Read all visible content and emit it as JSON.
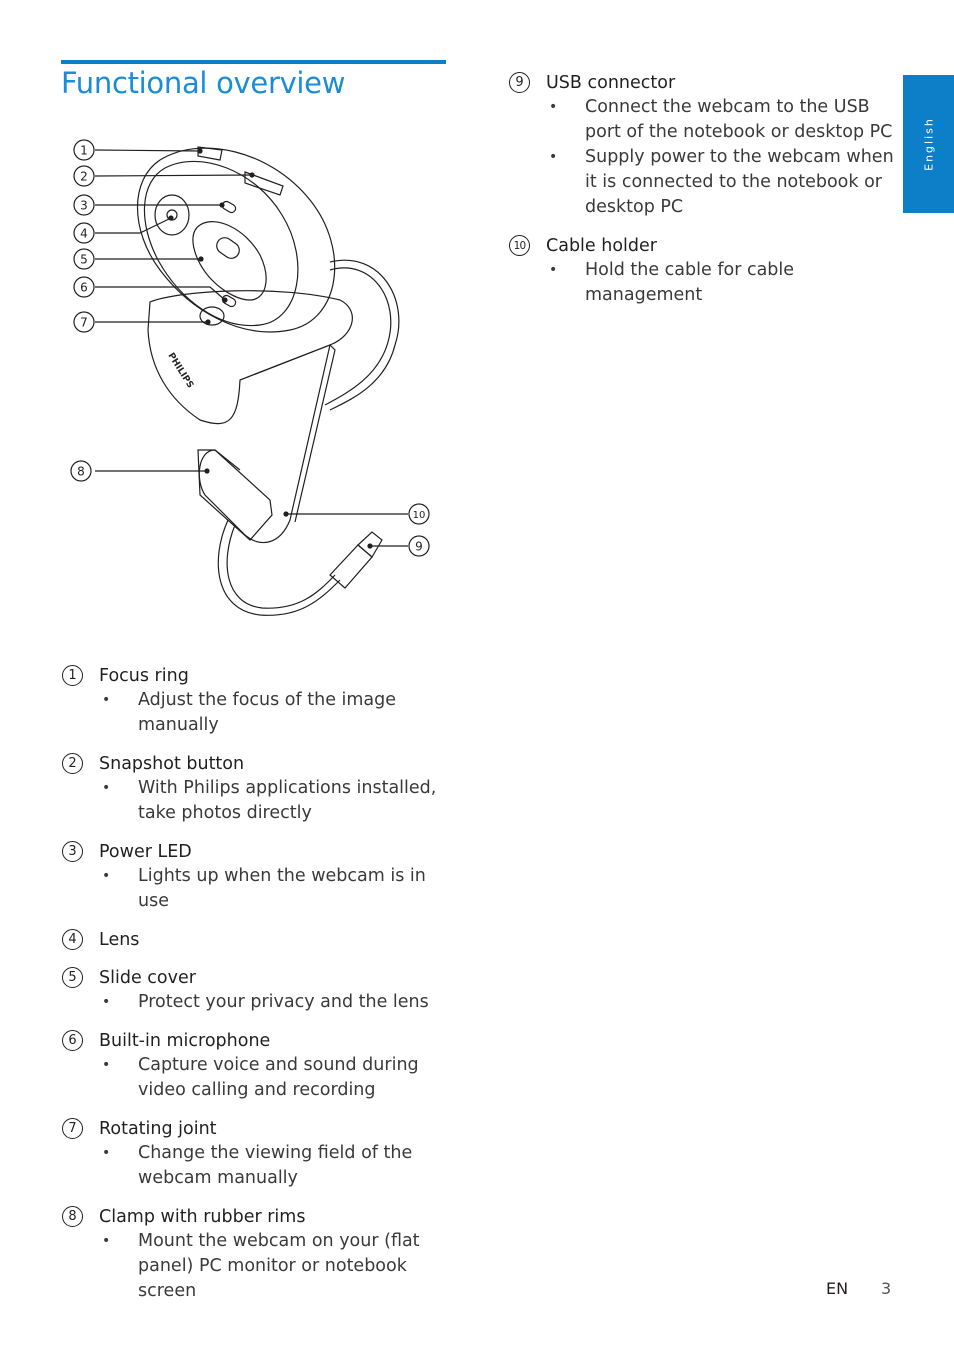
{
  "page": {
    "title": "Functional overview",
    "language_tab": "English",
    "footer": {
      "lang": "EN",
      "page_number": "3"
    }
  },
  "colors": {
    "accent": "#0d7fc9",
    "title": "#1a8dd7",
    "text": "#231f20"
  },
  "diagram": {
    "callouts": [
      "1",
      "2",
      "3",
      "4",
      "5",
      "6",
      "7",
      "8",
      "10",
      "9"
    ],
    "brand_text": "PHILIPS"
  },
  "left_items": [
    {
      "num": "1",
      "title": "Focus ring",
      "bullets": [
        "Adjust the focus of the image",
        "manually"
      ]
    },
    {
      "num": "2",
      "title": "Snapshot button",
      "bullets": [
        "With Philips applications installed,",
        "take photos directly"
      ]
    },
    {
      "num": "3",
      "title": "Power LED",
      "bullets": [
        "Lights up when the webcam is in use"
      ]
    },
    {
      "num": "4",
      "title": "Lens",
      "bullets": []
    },
    {
      "num": "5",
      "title": "Slide cover",
      "bullets": [
        "Protect your privacy and the lens"
      ]
    },
    {
      "num": "6",
      "title": "Built-in microphone",
      "bullets": [
        "Capture voice and sound during",
        "video calling and recording"
      ]
    },
    {
      "num": "7",
      "title": "Rotating joint",
      "bullets": [
        "Change the viewing field of the",
        "webcam manually"
      ]
    },
    {
      "num": "8",
      "title": "Clamp with rubber rims",
      "bullets": [
        "Mount the webcam on your (flat",
        "panel) PC monitor or notebook screen"
      ]
    }
  ],
  "right_items": [
    {
      "num": "9",
      "title": "USB connector",
      "bullets": [
        [
          "Connect the webcam to the USB",
          "port of the notebook or desktop PC"
        ],
        [
          "Supply power to the webcam when",
          "it is connected to the notebook or",
          "desktop PC"
        ]
      ]
    },
    {
      "num": "10",
      "title": "Cable holder",
      "bullets": [
        [
          "Hold the cable for cable",
          "management"
        ]
      ]
    }
  ]
}
